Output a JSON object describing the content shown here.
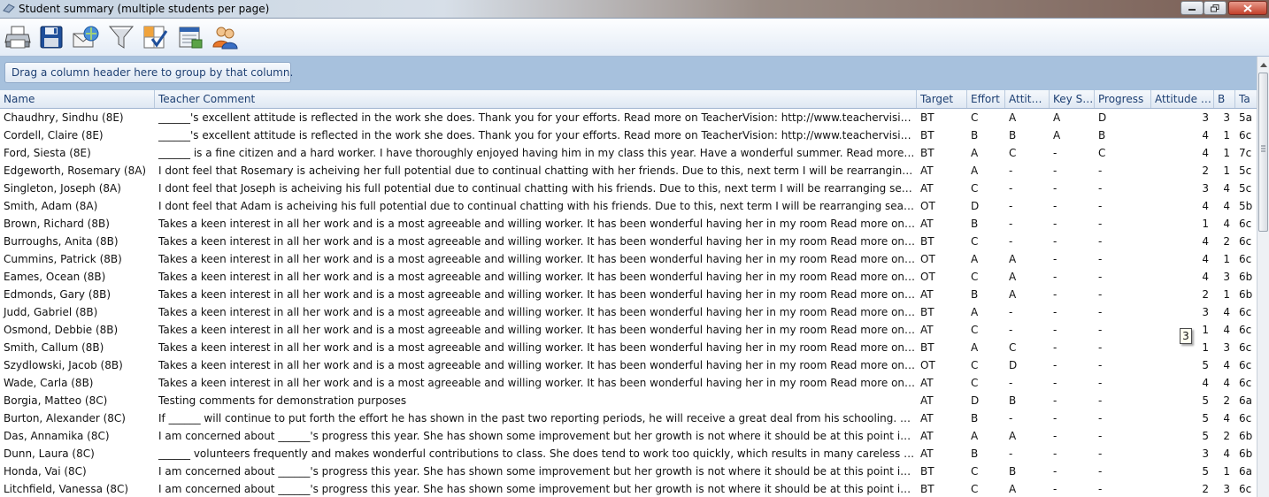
{
  "window": {
    "title": "Student summary (multiple students per page)"
  },
  "toolbar": {
    "buttons": [
      {
        "icon": "printer-icon"
      },
      {
        "icon": "save-icon"
      },
      {
        "icon": "email-icon"
      },
      {
        "icon": "filter-icon"
      },
      {
        "icon": "checklist-icon"
      },
      {
        "icon": "report-icon"
      },
      {
        "icon": "users-icon"
      }
    ]
  },
  "group_panel": {
    "hint": "Drag a column header here to group by that column."
  },
  "columns": [
    "Name",
    "Teacher Comment",
    "Target",
    "Effort",
    "Attitude",
    "Key Skills",
    "Progress",
    "Attitude Score",
    "B",
    "Ta"
  ],
  "rows": [
    [
      "Chaudhry, Sindhu (8E)",
      "______'s excellent attitude is reflected in the work she does. Thank you for your efforts.  Read more on TeacherVision: http://www.teachervision.com",
      "BT",
      "C",
      "A",
      "A",
      "D",
      "3",
      "3",
      "5a"
    ],
    [
      "Cordell, Claire (8E)",
      "______'s excellent attitude is reflected in the work she does. Thank you for your efforts.  Read more on TeacherVision: http://www.teachervision.com",
      "BT",
      "B",
      "B",
      "A",
      "B",
      "4",
      "1",
      "6c"
    ],
    [
      "Ford, Siesta (8E)",
      "______ is a fine citizen and a hard worker. I have thoroughly enjoyed having him in my class this year. Have a wonderful summer.  Read more on TeacherVision",
      "BT",
      "A",
      "C",
      "-",
      "C",
      "4",
      "1",
      "7c"
    ],
    [
      "Edgeworth, Rosemary (8A)",
      "I dont feel that Rosemary is acheiving her full potential due to continual chatting with her friends.  Due to this, next term I will be rearranging seats in class",
      "AT",
      "A",
      "-",
      "-",
      "-",
      "2",
      "1",
      "5c"
    ],
    [
      "Singleton, Joseph (8A)",
      "I dont feel that Joseph is acheiving his full potential due to continual chatting with his friends.  Due to this, next term I will be rearranging seats in class",
      "AT",
      "C",
      "-",
      "-",
      "-",
      "3",
      "4",
      "5c"
    ],
    [
      "Smith, Adam (8A)",
      "I dont feel that Adam is acheiving his full potential due to continual chatting with his friends.  Due to this, next term I will be rearranging seats and class",
      "OT",
      "D",
      "-",
      "-",
      "-",
      "4",
      "4",
      "5b"
    ],
    [
      "Brown, Richard (8B)",
      "Takes a keen interest in all her work and is a most agreeable and willing worker. It has been wonderful having her in my room Read more on TeacherVision",
      "AT",
      "B",
      "-",
      "-",
      "-",
      "1",
      "4",
      "6c"
    ],
    [
      "Burroughs, Anita (8B)",
      "Takes a keen interest in all her work and is a most agreeable and willing worker. It has been wonderful having her in my room Read more on TeacherVision",
      "BT",
      "C",
      "-",
      "-",
      "-",
      "4",
      "2",
      "6c"
    ],
    [
      "Cummins, Patrick (8B)",
      "Takes a keen interest in all her work and is a most agreeable and willing worker. It has been wonderful having her in my room Read more on TeacherVision",
      "OT",
      "A",
      "A",
      "-",
      "-",
      "4",
      "1",
      "6c"
    ],
    [
      "Eames, Ocean (8B)",
      "Takes a keen interest in all her work and is a most agreeable and willing worker. It has been wonderful having her in my room Read more on TeacherVision",
      "OT",
      "C",
      "A",
      "-",
      "-",
      "4",
      "3",
      "6b"
    ],
    [
      "Edmonds, Gary (8B)",
      "Takes a keen interest in all her work and is a most agreeable and willing worker. It has been wonderful having her in my room Read more on TeacherVision",
      "AT",
      "B",
      "A",
      "-",
      "-",
      "2",
      "1",
      "6b"
    ],
    [
      "Judd, Gabriel (8B)",
      "Takes a keen interest in all her work and is a most agreeable and willing worker. It has been wonderful having her in my room Read more on TeacherVision",
      "BT",
      "A",
      "-",
      "-",
      "-",
      "3",
      "4",
      "6c"
    ],
    [
      "Osmond, Debbie (8B)",
      "Takes a keen interest in all her work and is a most agreeable and willing worker. It has been wonderful having her in my room Read more on TeacherVision",
      "AT",
      "C",
      "-",
      "-",
      "-",
      "1",
      "4",
      "6c"
    ],
    [
      "Smith, Callum (8B)",
      "Takes a keen interest in all her work and is a most agreeable and willing worker. It has been wonderful having her in my room Read more on TeacherVision",
      "BT",
      "A",
      "C",
      "-",
      "-",
      "1",
      "3",
      "6c"
    ],
    [
      "Szydlowski, Jacob (8B)",
      "Takes a keen interest in all her work and is a most agreeable and willing worker. It has been wonderful having her in my room Read more on TeacherVision",
      "OT",
      "C",
      "D",
      "-",
      "-",
      "5",
      "4",
      "6c"
    ],
    [
      "Wade, Carla (8B)",
      "Takes a keen interest in all her work and is a most agreeable and willing worker. It has been wonderful having her in my room Read more on TeacherVision",
      "AT",
      "C",
      "-",
      "-",
      "-",
      "4",
      "4",
      "6c"
    ],
    [
      "Borgia, Matteo (8C)",
      "Testing comments for demonstration purposes",
      "AT",
      "D",
      "B",
      "-",
      "-",
      "5",
      "2",
      "6a"
    ],
    [
      "Burton, Alexander (8C)",
      " If ______ will continue to put forth the effort he has shown in the past two reporting periods, he will receive a great deal from his schooling.  Read more",
      "AT",
      "B",
      "-",
      "-",
      "-",
      "5",
      "4",
      "6c"
    ],
    [
      "Das, Annamika (8C)",
      "I am concerned about ______'s progress this year. She has shown some improvement but her growth is not where it should be at this point in the year",
      "AT",
      "A",
      "A",
      "-",
      "-",
      "5",
      "2",
      "6b"
    ],
    [
      "Dunn, Laura (8C)",
      " ______ volunteers frequently and makes wonderful contributions to class. She does tend to work too quickly, which results in many careless errors",
      "AT",
      "B",
      "-",
      "-",
      "-",
      "3",
      "4",
      "6b"
    ],
    [
      "Honda, Vai (8C)",
      "I am concerned about ______'s progress this year. She has shown some improvement but her growth is not where it should be at this point in the year",
      "BT",
      "C",
      "B",
      "-",
      "-",
      "5",
      "1",
      "6a"
    ],
    [
      "Litchfield, Vanessa (8C)",
      "I am concerned about ______'s progress this year. She has shown some improvement but her growth is not where it should be at this point in the year",
      "BT",
      "C",
      "A",
      "-",
      "-",
      "2",
      "3",
      "6c"
    ]
  ],
  "tooltip": {
    "text": "3"
  }
}
